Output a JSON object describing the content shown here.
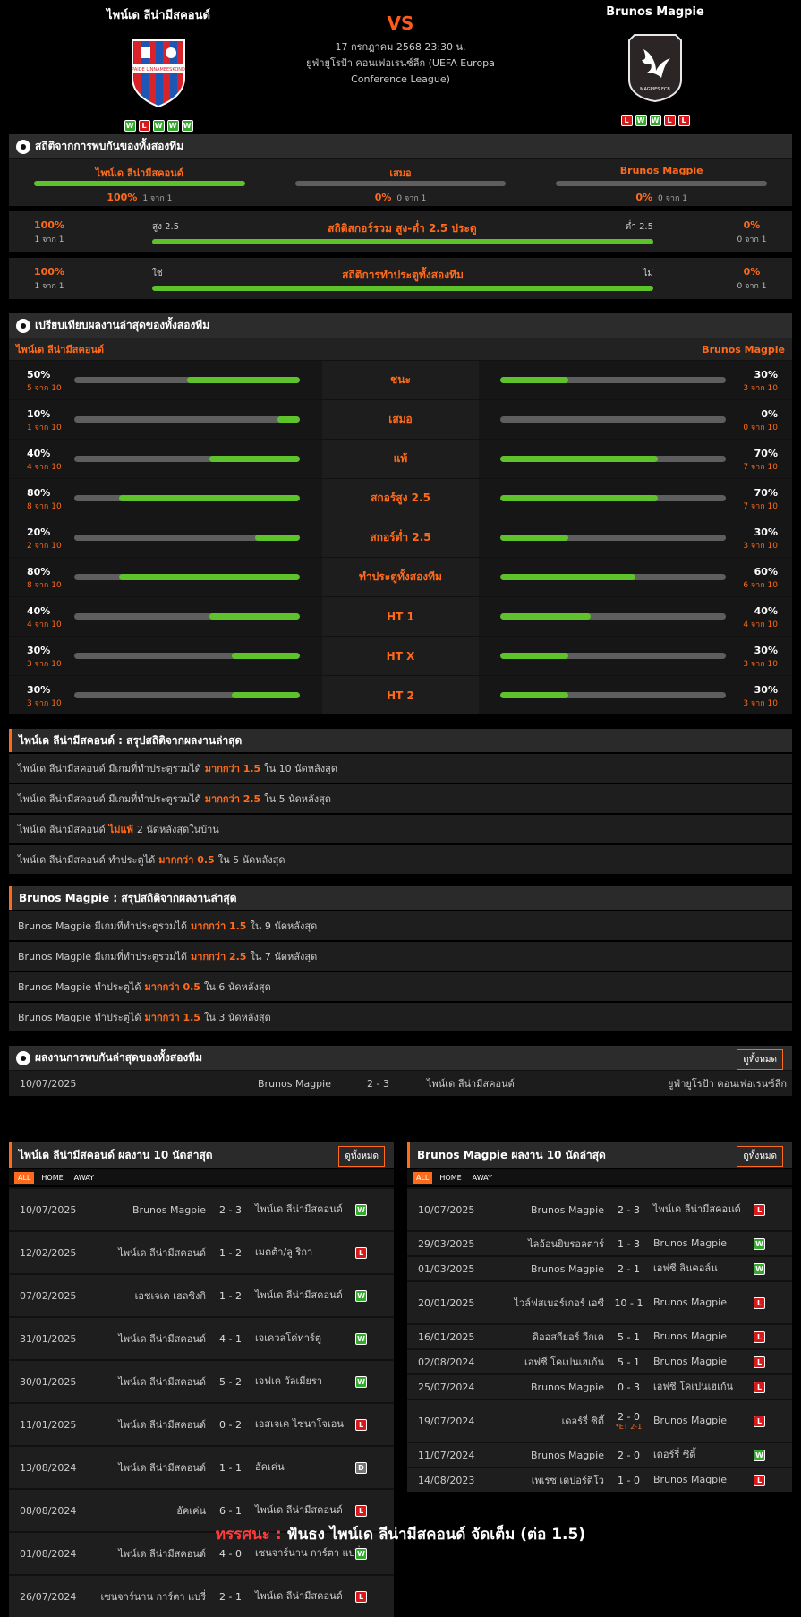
{
  "match": {
    "home": "ไพน์เด ลีน่ามีสคอนด์",
    "away": "Brunos Magpie",
    "vs": "VS",
    "datetime": "17 กรกฎาคม 2568 23:30 น.",
    "competition": "ยูฟ่ายูโรป้า คอนเฟอเรนซ์ลีก (UEFA Europa Conference League)",
    "home_form": [
      "W",
      "L",
      "W",
      "W",
      "W"
    ],
    "away_form": [
      "L",
      "W",
      "W",
      "L",
      "L"
    ],
    "home_crest_text": "PAIDE LINNAMEESKOND",
    "away_crest_text": "MAGPIES FCB"
  },
  "h2h_stats": {
    "title": "สถิติจากการพบกันของทั้งสองทีม",
    "cols": [
      {
        "label": "ไพน์เด ลีน่ามีสคอนด์",
        "pct": "100%",
        "sub": "1 จาก 1",
        "fill": 1
      },
      {
        "label": "เสมอ",
        "pct": "0%",
        "sub": "0 จาก 1",
        "fill": 0
      },
      {
        "label": "Brunos Magpie",
        "pct": "0%",
        "sub": "0 จาก 1",
        "fill": 0
      }
    ],
    "rows": [
      {
        "lpct": "100%",
        "lsub": "1 จาก 1",
        "left": "สูง 2.5",
        "title": "สถิติสกอร์รวม สูง-ต่ำ 2.5 ประตู",
        "right": "ต่ำ 2.5",
        "rpct": "0%",
        "rsub": "0 จาก 1",
        "fill": 1
      },
      {
        "lpct": "100%",
        "lsub": "1 จาก 1",
        "left": "ใช่",
        "title": "สถิติการทำประตูทั้งสองทีม",
        "right": "ไม่",
        "rpct": "0%",
        "rsub": "0 จาก 1",
        "fill": 1
      }
    ]
  },
  "compare": {
    "title": "เปรียบเทียบผลงานล่าสุดของทั้งสองทีม",
    "home": "ไพน์เด ลีน่ามีสคอนด์",
    "away": "Brunos Magpie",
    "rows": [
      {
        "label": "ชนะ",
        "lp": "50%",
        "ls": "5 จาก 10",
        "lv": 0.5,
        "rp": "30%",
        "rs": "3 จาก 10",
        "rv": 0.3
      },
      {
        "label": "เสมอ",
        "lp": "10%",
        "ls": "1 จาก 10",
        "lv": 0.1,
        "rp": "0%",
        "rs": "0 จาก 10",
        "rv": 0
      },
      {
        "label": "แพ้",
        "lp": "40%",
        "ls": "4 จาก 10",
        "lv": 0.4,
        "rp": "70%",
        "rs": "7 จาก 10",
        "rv": 0.7
      },
      {
        "label": "สกอร์สูง 2.5",
        "lp": "80%",
        "ls": "8 จาก 10",
        "lv": 0.8,
        "rp": "70%",
        "rs": "7 จาก 10",
        "rv": 0.7
      },
      {
        "label": "สกอร์ต่ำ 2.5",
        "lp": "20%",
        "ls": "2 จาก 10",
        "lv": 0.2,
        "rp": "30%",
        "rs": "3 จาก 10",
        "rv": 0.3
      },
      {
        "label": "ทำประตูทั้งสองทีม",
        "lp": "80%",
        "ls": "8 จาก 10",
        "lv": 0.8,
        "rp": "60%",
        "rs": "6 จาก 10",
        "rv": 0.6
      },
      {
        "label": "HT 1",
        "lp": "40%",
        "ls": "4 จาก 10",
        "lv": 0.4,
        "rp": "40%",
        "rs": "4 จาก 10",
        "rv": 0.4
      },
      {
        "label": "HT X",
        "lp": "30%",
        "ls": "3 จาก 10",
        "lv": 0.3,
        "rp": "30%",
        "rs": "3 จาก 10",
        "rv": 0.3
      },
      {
        "label": "HT 2",
        "lp": "30%",
        "ls": "3 จาก 10",
        "lv": 0.3,
        "rp": "30%",
        "rs": "3 จาก 10",
        "rv": 0.3
      }
    ]
  },
  "home_summary": {
    "title": "ไพน์เด ลีน่ามีสคอนด์ : สรุปสถิติจากผลงานล่าสุด",
    "rows": [
      {
        "a": "ไพน์เด ลีน่ามีสคอนด์  มีเกมที่ทำประตูรวมได้",
        "b": "มากกว่า  1.5",
        "c": "ใน 10 นัดหลังสุด"
      },
      {
        "a": "ไพน์เด ลีน่ามีสคอนด์  มีเกมที่ทำประตูรวมได้",
        "b": "มากกว่า  2.5",
        "c": "ใน 5 นัดหลังสุด"
      },
      {
        "a": "ไพน์เด ลีน่ามีสคอนด์",
        "b": "ไม่แพ้",
        "c": "2  นัดหลังสุดในบ้าน"
      },
      {
        "a": "ไพน์เด ลีน่ามีสคอนด์  ทำประตูได้",
        "b": "มากกว่า  0.5",
        "c": "ใน 5 นัดหลังสุด"
      }
    ]
  },
  "away_summary": {
    "title": "Brunos Magpie : สรุปสถิติจากผลงานล่าสุด",
    "rows": [
      {
        "a": "Brunos Magpie  มีเกมที่ทำประตูรวมได้",
        "b": "มากกว่า  1.5",
        "c": "ใน 9 นัดหลังสุด"
      },
      {
        "a": "Brunos Magpie  มีเกมที่ทำประตูรวมได้",
        "b": "มากกว่า  2.5",
        "c": "ใน 7 นัดหลังสุด"
      },
      {
        "a": "Brunos Magpie  ทำประตูได้",
        "b": "มากกว่า  0.5",
        "c": "ใน 6 นัดหลังสุด"
      },
      {
        "a": "Brunos Magpie  ทำประตูได้",
        "b": "มากกว่า  1.5",
        "c": "ใน 3 นัดหลังสุด"
      }
    ]
  },
  "h2h_results": {
    "title": "ผลงานการพบกันล่าสุดของทั้งสองทีม",
    "btn": "ดูทั้งหมด",
    "rows": [
      {
        "date": "10/07/2025",
        "home": "Brunos Magpie",
        "score": "2 - 3",
        "away": "ไพน์เด ลีน่ามีสคอนด์",
        "comp": "ยูฟ่ายูโรป้า คอนเฟอเรนซ์ลีก"
      }
    ]
  },
  "tabs": [
    "ALL",
    "HOME",
    "AWAY"
  ],
  "home_last10": {
    "title": "ไพน์เด ลีน่ามีสคอนด์ ผลงาน 10 นัดล่าสุด",
    "btn": "ดูทั้งหมด",
    "rows": [
      {
        "date": "10/07/2025",
        "home": "Brunos Magpie",
        "score": "2 - 3",
        "away": "ไพน์เด ลีน่ามีสคอนด์",
        "res": "W"
      },
      {
        "date": "12/02/2025",
        "home": "ไพน์เด ลีน่ามีสคอนด์",
        "score": "1 - 2",
        "away": "เมตต้า/ลู ริกา",
        "res": "L"
      },
      {
        "date": "07/02/2025",
        "home": "เอชเจเค เฮลซิงกิ",
        "score": "1 - 2",
        "away": "ไพน์เด ลีน่ามีสคอนด์",
        "res": "W"
      },
      {
        "date": "31/01/2025",
        "home": "ไพน์เด ลีน่ามีสคอนด์",
        "score": "4 - 1",
        "away": "เจเควลโค่ทาร์ตู",
        "res": "W"
      },
      {
        "date": "30/01/2025",
        "home": "ไพน์เด ลีน่ามีสคอนด์",
        "score": "5 - 2",
        "away": "เจฟเค วัลเมียรา",
        "res": "W"
      },
      {
        "date": "11/01/2025",
        "home": "ไพน์เด ลีน่ามีสคอนด์",
        "score": "0 - 2",
        "away": "เอสเจเค ไซนาโจเอน",
        "res": "L"
      },
      {
        "date": "13/08/2024",
        "home": "ไพน์เด ลีน่ามีสคอนด์",
        "score": "1 - 1",
        "away": "อัคเค่น",
        "res": "D"
      },
      {
        "date": "08/08/2024",
        "home": "อัคเค่น",
        "score": "6 - 1",
        "away": "ไพน์เด ลีน่ามีสคอนด์",
        "res": "L"
      },
      {
        "date": "01/08/2024",
        "home": "ไพน์เด ลีน่ามีสคอนด์",
        "score": "4 - 0",
        "away": "เซนจาร์นาน การ์ตา แบรี่",
        "res": "W"
      },
      {
        "date": "26/07/2024",
        "home": "เซนจาร์นาน การ์ตา แบรี่",
        "score": "2 - 1",
        "away": "ไพน์เด ลีน่ามีสคอนด์",
        "res": "L"
      }
    ]
  },
  "away_last10": {
    "title": "Brunos Magpie ผลงาน 10 นัดล่าสุด",
    "btn": "ดูทั้งหมด",
    "rows": [
      {
        "date": "10/07/2025",
        "home": "Brunos Magpie",
        "score": "2 - 3",
        "away": "ไพน์เด ลีน่ามีสคอนด์",
        "res": "L"
      },
      {
        "date": "29/03/2025",
        "home": "ไลอ้อนยิบรอลตาร์",
        "score": "1 - 3",
        "away": "Brunos Magpie",
        "res": "W"
      },
      {
        "date": "01/03/2025",
        "home": "Brunos Magpie",
        "score": "2 - 1",
        "away": "เอฟซี ลินคอล์น",
        "res": "W"
      },
      {
        "date": "20/01/2025",
        "home": "ไวล์ฟสเบอร์เกอร์ เอซี",
        "score": "10 - 1",
        "away": "Brunos Magpie",
        "res": "L"
      },
      {
        "date": "16/01/2025",
        "home": "ดิออสกียอร์ วีกเค",
        "score": "5 - 1",
        "away": "Brunos Magpie",
        "res": "L"
      },
      {
        "date": "02/08/2024",
        "home": "เอฟซี โคเปนเฮเก้น",
        "score": "5 - 1",
        "away": "Brunos Magpie",
        "res": "L"
      },
      {
        "date": "25/07/2024",
        "home": "Brunos Magpie",
        "score": "0 - 3",
        "away": "เอฟซี โคเปนเฮเก้น",
        "res": "L"
      },
      {
        "date": "19/07/2024",
        "home": "เดอร์รี่ ซิตี้",
        "score": "2 - 0",
        "et": "*ET 2-1",
        "away": "Brunos Magpie",
        "res": "L"
      },
      {
        "date": "11/07/2024",
        "home": "Brunos Magpie",
        "score": "2 - 0",
        "away": "เดอร์รี่ ซิตี้",
        "res": "W"
      },
      {
        "date": "14/08/2023",
        "home": "เพเรซ เดปอร์ติโว",
        "score": "1 - 0",
        "away": "Brunos Magpie",
        "res": "L"
      }
    ]
  },
  "verdict": {
    "label": "ทรรศนะ :",
    "text": " ฟันธง ไพน์เด ลีน่ามีสคอนด์ จัดเต็ม (ต่อ 1.5)"
  },
  "colors": {
    "accent": "#ff6b1a",
    "bar_fill": "#5ec22b",
    "bar_bg": "#5e5e5e"
  }
}
